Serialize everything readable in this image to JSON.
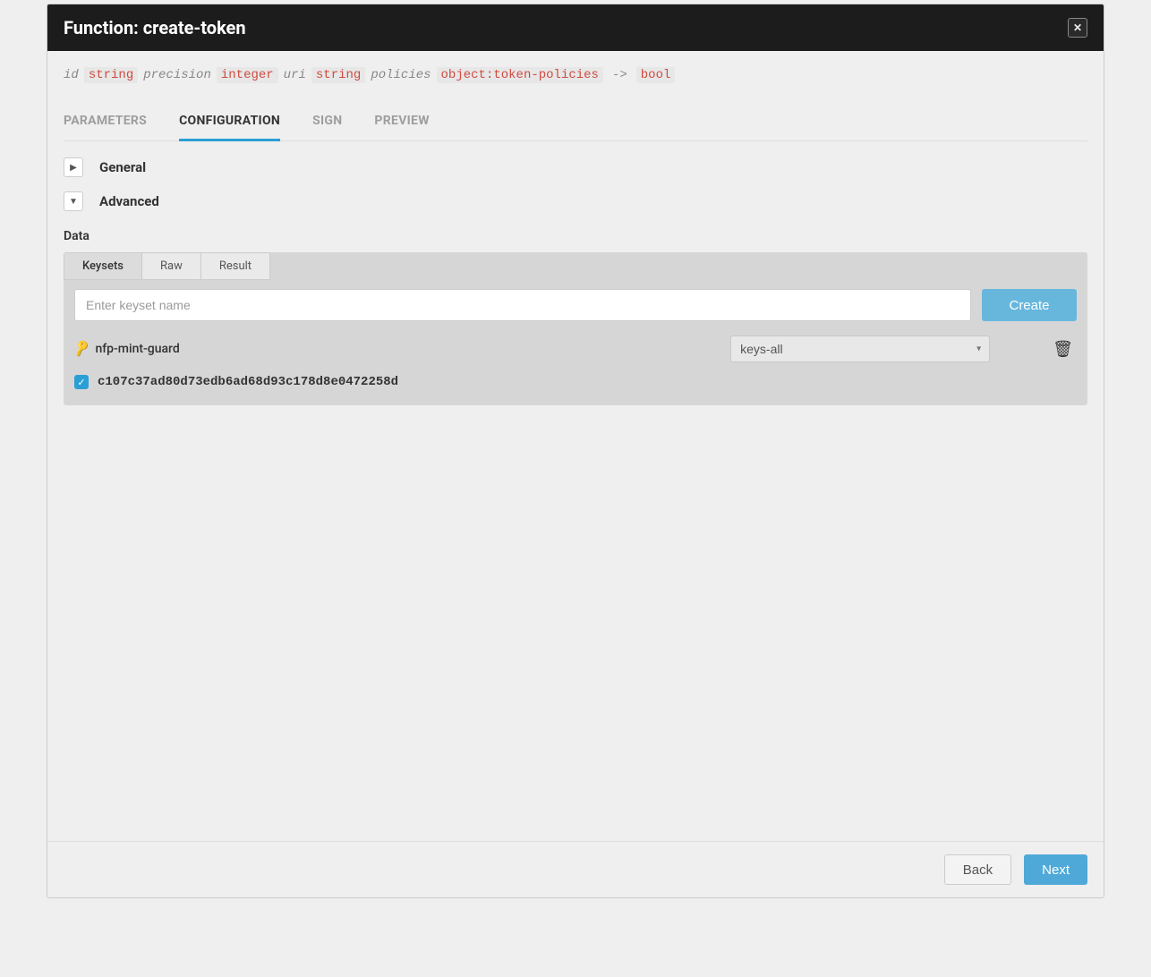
{
  "header": {
    "title": "Function: create-token"
  },
  "signature": {
    "params": [
      {
        "name": "id",
        "type": "string"
      },
      {
        "name": "precision",
        "type": "integer"
      },
      {
        "name": "uri",
        "type": "string"
      },
      {
        "name": "policies",
        "type": "object:token-policies"
      }
    ],
    "arrow": "->",
    "return_type": "bool"
  },
  "tabs": {
    "parameters": "PARAMETERS",
    "configuration": "CONFIGURATION",
    "sign": "SIGN",
    "preview": "PREVIEW",
    "active": "configuration"
  },
  "sections": {
    "general": "General",
    "advanced": "Advanced"
  },
  "data_label": "Data",
  "subtabs": {
    "keysets": "Keysets",
    "raw": "Raw",
    "result": "Result",
    "active": "keysets"
  },
  "keyset_panel": {
    "input_placeholder": "Enter keyset name",
    "create_label": "Create",
    "keyset_name": "nfp-mint-guard",
    "predicate": "keys-all",
    "key_hash": "c107c37ad80d73edb6ad68d93c178d8e0472258d",
    "key_checked": true
  },
  "footer": {
    "back": "Back",
    "next": "Next"
  }
}
